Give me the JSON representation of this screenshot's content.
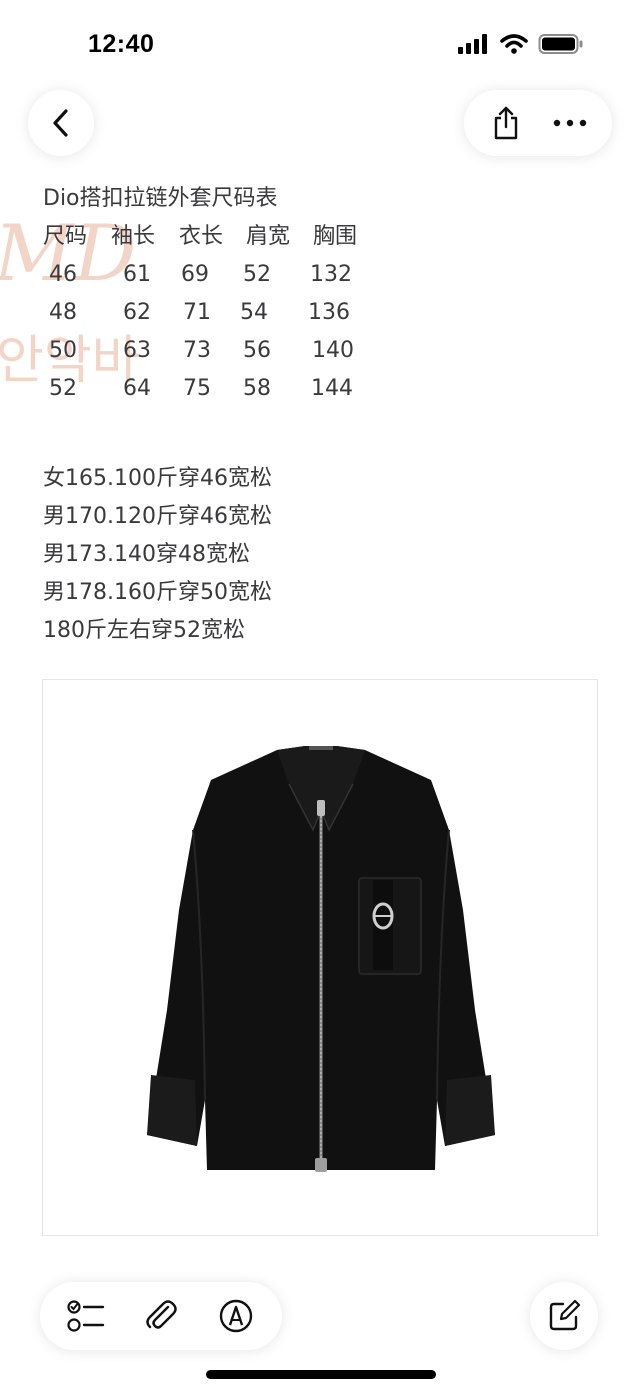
{
  "status_bar": {
    "time": "12:40",
    "icons": [
      "cellular-signal-icon",
      "wifi-icon",
      "battery-icon"
    ]
  },
  "navigation": {
    "back_icon": "chevron-left-icon",
    "share_icon": "share-icon",
    "more_icon": "more-icon"
  },
  "note": {
    "title": "Dio搭扣拉链外套尺码表",
    "table": {
      "headers": [
        "尺码",
        "袖长",
        "衣长",
        "肩宽",
        "胸围"
      ],
      "rows": [
        [
          "46",
          "61",
          "69",
          "52",
          "132"
        ],
        [
          "48",
          "62",
          "71",
          "54",
          "136"
        ],
        [
          "50",
          "63",
          "73",
          "56",
          "140"
        ],
        [
          "52",
          "64",
          "75",
          "58",
          "144"
        ]
      ]
    },
    "fit_lines": [
      "女165.100斤穿46宽松",
      "男170.120斤穿46宽松",
      "男173.140穿48宽松",
      "男178.160斤穿50宽松",
      "180斤左右穿52宽松"
    ],
    "watermark_text": [
      "MD",
      "안악바"
    ],
    "image_subject": "black zip-up shirt jacket with buckle chest pocket"
  },
  "toolbar": {
    "checklist_icon": "checklist-icon",
    "attachment_icon": "paperclip-icon",
    "markup_icon": "markup-pen-icon",
    "compose_icon": "compose-icon"
  },
  "colors": {
    "text": "#3a3a3c",
    "watermark": "#e8b49a",
    "jacket": "#111111"
  }
}
